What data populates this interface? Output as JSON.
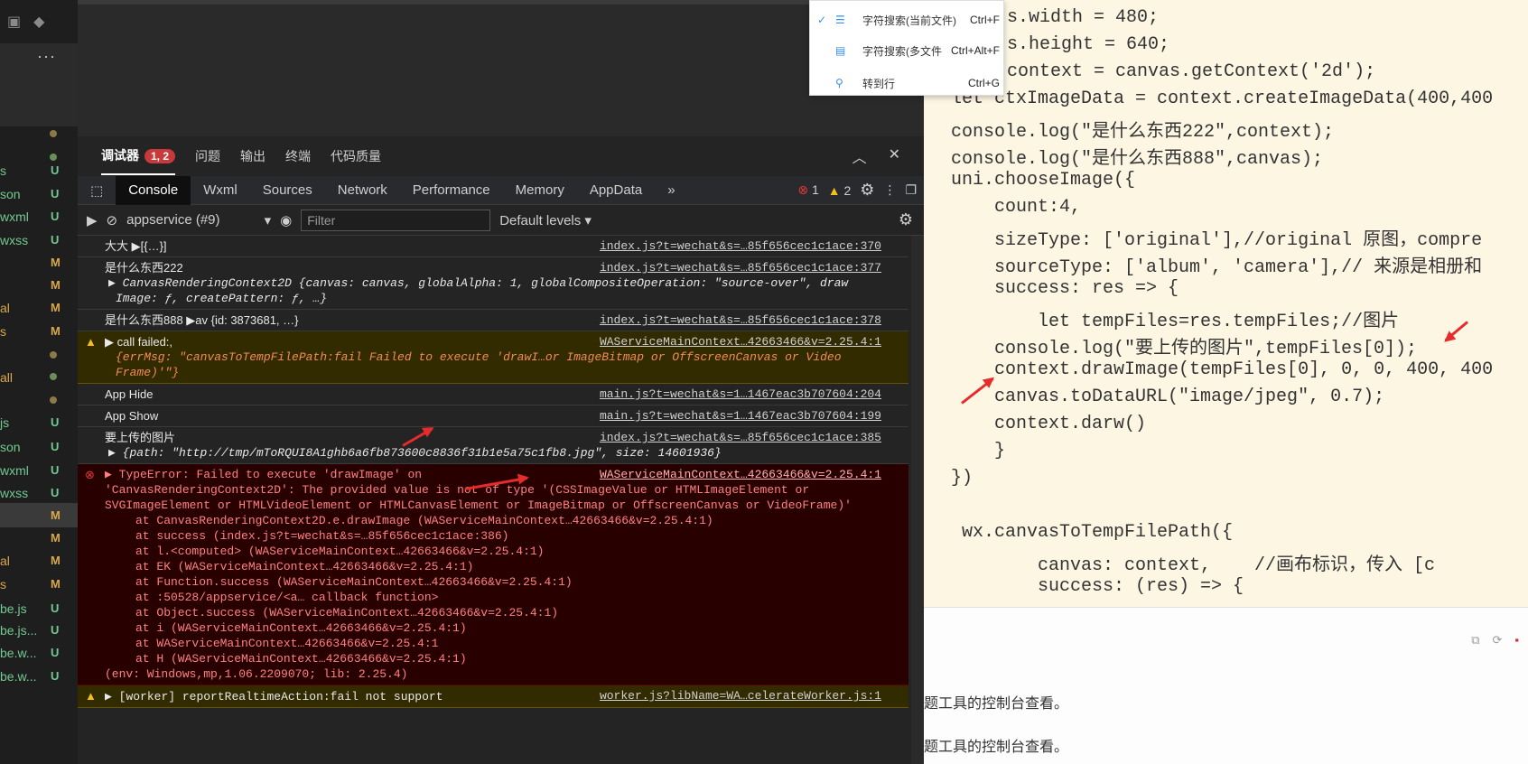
{
  "tree": {
    "rows": [
      {
        "name": "s",
        "badge": "U"
      },
      {
        "name": "son",
        "badge": "U"
      },
      {
        "name": "wxml",
        "badge": "U"
      },
      {
        "name": "wxss",
        "badge": "U"
      },
      {
        "name": "",
        "badge": "M"
      },
      {
        "name": "",
        "badge": "M"
      },
      {
        "name": "al",
        "badge": "M"
      },
      {
        "name": "s",
        "badge": "M"
      },
      {
        "name": "",
        "badge": ""
      },
      {
        "name": "all",
        "badge": ""
      },
      {
        "name": "",
        "badge": ""
      },
      {
        "name": "js",
        "badge": "U"
      },
      {
        "name": "son",
        "badge": "U"
      },
      {
        "name": "wxml",
        "badge": "U"
      },
      {
        "name": "wxss",
        "badge": "U"
      },
      {
        "name": "",
        "badge": "M"
      },
      {
        "name": "",
        "badge": "M"
      },
      {
        "name": "al",
        "badge": "M"
      },
      {
        "name": "s",
        "badge": "M"
      },
      {
        "name": "be.js",
        "badge": "U"
      },
      {
        "name": "be.js...",
        "badge": "U"
      },
      {
        "name": "be.w...",
        "badge": "U"
      },
      {
        "name": "be.w...",
        "badge": "U"
      }
    ],
    "more": "···"
  },
  "panel_tabs": {
    "debugger": "调试器",
    "debugger_badge": "1, 2",
    "problems": "问题",
    "output": "输出",
    "terminal": "终端",
    "code_quality": "代码质量"
  },
  "dev_tabs": [
    "Console",
    "Wxml",
    "Sources",
    "Network",
    "Performance",
    "Memory",
    "AppData"
  ],
  "dev_counts": {
    "errors": "1",
    "warnings": "2"
  },
  "console_toolbar": {
    "context": "appservice (#9)",
    "filter_placeholder": "Filter",
    "levels": "Default levels"
  },
  "log": {
    "l1": {
      "text": "大大 ▶[{…}]",
      "src": "index.js?t=wechat&s=…85f656cec1c1ace:370"
    },
    "l2": {
      "title": "是什么东西222",
      "obj": "CanvasRenderingContext2D {canvas: canvas, globalAlpha: 1, globalCompositeOperation: \"source-over\", draw",
      "obj2": "Image: ƒ, createPattern: ƒ, …}",
      "src": "index.js?t=wechat&s=…85f656cec1c1ace:377"
    },
    "l3": {
      "text": "是什么东西888 ▶av {id: 3873681, …}",
      "src": "index.js?t=wechat&s=…85f656cec1c1ace:378"
    },
    "l4": {
      "title": "call failed:,",
      "obj": "{errMsg: \"canvasToTempFilePath:fail Failed to execute 'drawI…or ImageBitmap or OffscreenCanvas or Video",
      "obj2": "Frame)'\"}",
      "src": "WAServiceMainContext…42663466&v=2.25.4:1"
    },
    "l5": {
      "text": "App Hide",
      "src": "main.js?t=wechat&s=1…1467eac3b707604:204"
    },
    "l6": {
      "text": "App Show",
      "src": "main.js?t=wechat&s=1…1467eac3b707604:199"
    },
    "l7": {
      "title": "要上传的图片",
      "obj": "{path: \"http://tmp/mToRQUI8A1ghb6a6fb873600c8836f31b1e5a75c1fb8.jpg\", size: 14601936}",
      "src": "index.js?t=wechat&s=…85f656cec1c1ace:385"
    },
    "err": {
      "head": "TypeError: Failed to execute 'drawImage' on",
      "src": "WAServiceMainContext…42663466&v=2.25.4:1",
      "body": "'CanvasRenderingContext2D': The provided value is not of type '(CSSImageValue or HTMLImageElement or SVGImageElement or HTMLVideoElement or HTMLCanvasElement or ImageBitmap or OffscreenCanvas or VideoFrame)'",
      "stack": [
        "at CanvasRenderingContext2D.e.drawImage (WAServiceMainContext…42663466&v=2.25.4:1)",
        "at success (index.js?t=wechat&s=…85f656cec1c1ace:386)",
        "at l.<computed> (WAServiceMainContext…42663466&v=2.25.4:1)",
        "at EK (WAServiceMainContext…42663466&v=2.25.4:1)",
        "at Function.success (WAServiceMainContext…42663466&v=2.25.4:1)",
        "at :50528/appservice/<a… callback function>",
        "at Object.success (WAServiceMainContext…42663466&v=2.25.4:1)",
        "at i (WAServiceMainContext…42663466&v=2.25.4:1)",
        "at WAServiceMainContext…42663466&v=2.25.4:1",
        "at H (WAServiceMainContext…42663466&v=2.25.4:1)"
      ],
      "env": "(env: Windows,mp,1.06.2209070; lib: 2.25.4)"
    },
    "w2": {
      "text": "[worker] reportRealtimeAction:fail not support",
      "src": "worker.js?libName=WA…celerateWorker.js:1"
    }
  },
  "menu": {
    "items": [
      {
        "label": "字符搜索(当前文件)",
        "shortcut": "Ctrl+F",
        "checked": true
      },
      {
        "label": "字符搜索(多文件",
        "shortcut": "Ctrl+Alt+F",
        "checked": false
      },
      {
        "label": "转到行",
        "shortcut": "Ctrl+G",
        "checked": false
      }
    ]
  },
  "code_lines": [
    "s.width = 480;",
    "s.height = 640;",
    "context = canvas.getContext('2d');",
    "let ctxImageData = context.createImageData(400,400",
    "console.log(\"是什么东西222\",context);",
    "console.log(\"是什么东西888\",canvas);",
    "uni.chooseImage({",
    "    count:4,",
    "    sizeType: ['original'],//original 原图，compre",
    "    sourceType: ['album', 'camera'],// 来源是相册和",
    "    success: res => {",
    "        let tempFiles=res.tempFiles;//图片",
    "    console.log(\"要上传的图片\",tempFiles[0]);",
    "    context.drawImage(tempFiles[0], 0, 0, 400, 400",
    "    canvas.toDataURL(\"image/jpeg\", 0.7);",
    "    context.darw()",
    "    }",
    "})",
    "",
    " wx.canvasToTempFilePath({",
    "        canvas: context,    //画布标识，传入 [c",
    "        success: (res) => {"
  ],
  "bottom_text": [
    "题工具的控制台查看。",
    "题工具的控制台查看。"
  ],
  "colors": {
    "error_bg": "#290000",
    "warn_bg": "#332b00",
    "editor_bg": "#fdf6e3",
    "arrow": "#e52b2b"
  }
}
